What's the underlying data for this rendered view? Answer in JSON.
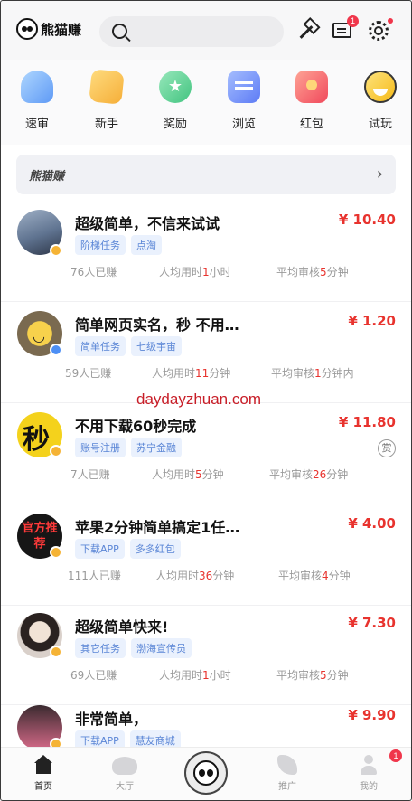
{
  "header": {
    "logo_text": "熊猫赚",
    "message_badge": "1"
  },
  "quick_menu": [
    {
      "label": "速审",
      "icon": "speed-review-icon"
    },
    {
      "label": "新手",
      "icon": "newbie-icon"
    },
    {
      "label": "奖励",
      "icon": "reward-icon"
    },
    {
      "label": "浏览",
      "icon": "browse-icon"
    },
    {
      "label": "红包",
      "icon": "red-packet-icon"
    },
    {
      "label": "试玩",
      "icon": "trial-play-icon"
    }
  ],
  "banner": {
    "text": "熊猫赚",
    "arrow": "›"
  },
  "tasks": [
    {
      "title": "超级简单，不信来试试",
      "price": "¥ 10.40",
      "tags": [
        "阶梯任务",
        "点淘"
      ],
      "earned_count": "76",
      "earned_suffix": "人已赚",
      "avg_prefix": "人均用时",
      "avg_value": "1",
      "avg_unit": "小时",
      "review_prefix": "平均审核",
      "review_value": "5",
      "review_unit": "分钟"
    },
    {
      "title": "简单网页实名，秒 不用…",
      "price": "¥ 1.20",
      "tags": [
        "简单任务",
        "七级宇宙"
      ],
      "earned_count": "59",
      "earned_suffix": "人已赚",
      "avg_prefix": "人均用时",
      "avg_value": "11",
      "avg_unit": "分钟",
      "review_prefix": "平均审核",
      "review_value": "1",
      "review_unit": "分钟内"
    },
    {
      "title": "不用下载60秒完成",
      "price": "¥ 11.80",
      "tags": [
        "账号注册",
        "苏宁金融"
      ],
      "earned_count": "7",
      "earned_suffix": "人已赚",
      "avg_prefix": "人均用时",
      "avg_value": "5",
      "avg_unit": "分钟",
      "review_prefix": "平均审核",
      "review_value": "26",
      "review_unit": "分钟",
      "reward_mark": "赏"
    },
    {
      "title": "苹果2分钟简单搞定1任…",
      "price": "¥ 4.00",
      "tags": [
        "下载APP",
        "多多红包"
      ],
      "avatar_text": "官方推荐",
      "earned_count": "111",
      "earned_suffix": "人已赚",
      "avg_prefix": "人均用时",
      "avg_value": "36",
      "avg_unit": "分钟",
      "review_prefix": "平均审核",
      "review_value": "4",
      "review_unit": "分钟"
    },
    {
      "title": "超级简单快来!",
      "price": "¥ 7.30",
      "tags": [
        "其它任务",
        "渤海宣传员"
      ],
      "earned_count": "69",
      "earned_suffix": "人已赚",
      "avg_prefix": "人均用时",
      "avg_value": "1",
      "avg_unit": "小时",
      "review_prefix": "平均审核",
      "review_value": "5",
      "review_unit": "分钟"
    },
    {
      "title": "非常简单，",
      "price": "¥ 9.90",
      "tags": [
        "下载APP",
        "慧友商城"
      ]
    }
  ],
  "watermark": "daydayzhuan.com",
  "bottom_nav": [
    {
      "label": "首页",
      "icon": "home-icon",
      "active": true
    },
    {
      "label": "大厅",
      "icon": "hall-icon"
    },
    {
      "label": "",
      "icon": "panda-icon"
    },
    {
      "label": "推广",
      "icon": "promote-icon"
    },
    {
      "label": "我的",
      "icon": "profile-icon",
      "badge": "1"
    }
  ]
}
